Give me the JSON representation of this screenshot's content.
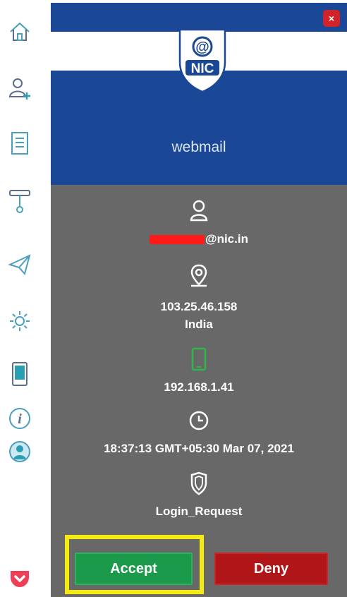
{
  "sidebar": {
    "items": [
      {
        "icon": "home-icon"
      },
      {
        "icon": "add-user-icon"
      },
      {
        "icon": "document-list-icon"
      },
      {
        "icon": "usb-key-icon"
      },
      {
        "icon": "paper-plane-icon"
      },
      {
        "icon": "gear-icon"
      },
      {
        "icon": "mobile-device-icon"
      },
      {
        "icon": "info-icon"
      },
      {
        "icon": "user-circle-icon"
      },
      {
        "icon": "pocket-logo-icon"
      }
    ]
  },
  "header": {
    "logo_text": "NIC",
    "logo_at": "@",
    "app_name": "webmail",
    "close_label": "×"
  },
  "request": {
    "email_suffix": "@nic.in",
    "ip_public": "103.25.46.158",
    "country": "India",
    "ip_device": "192.168.1.41",
    "timestamp": "18:37:13 GMT+05:30 Mar 07, 2021",
    "type": "Login_Request"
  },
  "actions": {
    "accept_label": "Accept",
    "deny_label": "Deny"
  },
  "colors": {
    "header_blue": "#1a4896",
    "panel_gray": "#686868",
    "accept_green": "#1a9a4a",
    "deny_red": "#b01518",
    "highlight_yellow": "#f5ea12",
    "icon_teal": "#2a9fb3",
    "device_green": "#2fb54a"
  }
}
